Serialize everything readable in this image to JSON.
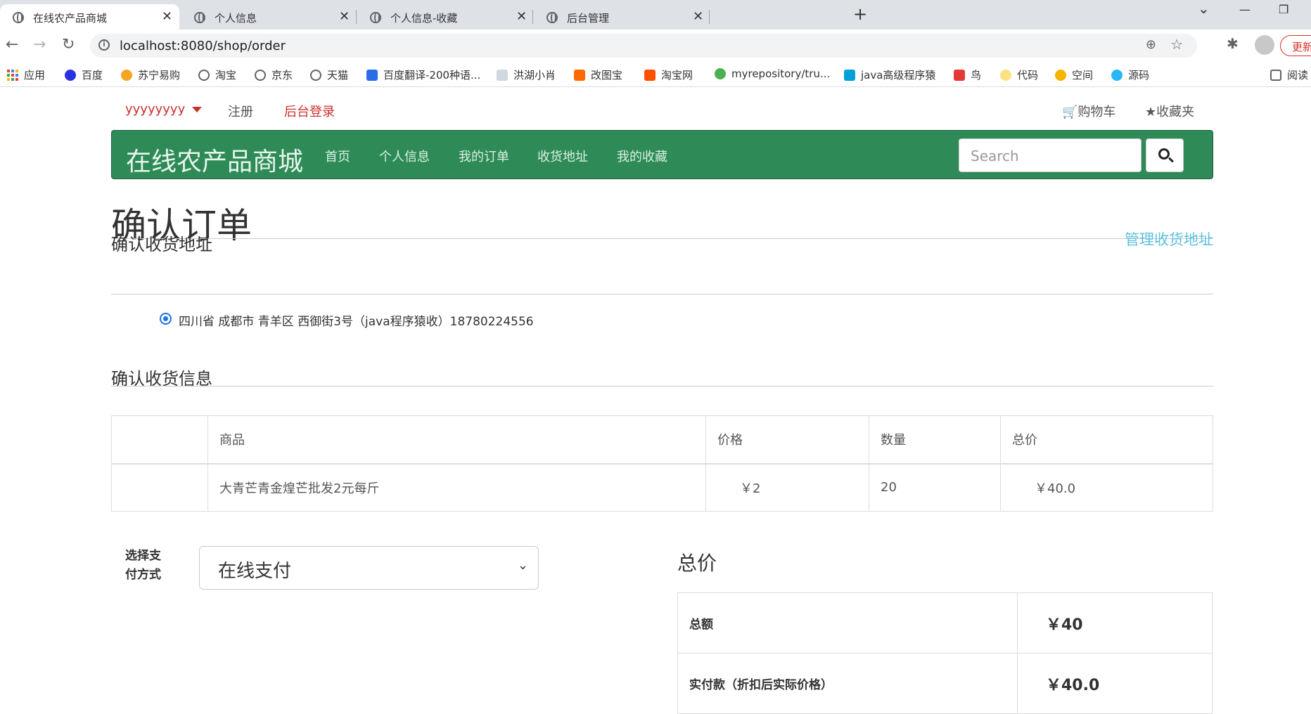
{
  "browser": {
    "tabs": [
      {
        "title": "在线农产品商城",
        "active": true
      },
      {
        "title": "个人信息",
        "active": false
      },
      {
        "title": "个人信息-收藏",
        "active": false
      },
      {
        "title": "后台管理",
        "active": false
      }
    ],
    "url": "localhost:8080/shop/order",
    "update_label": "更新",
    "bookmarks": [
      "应用",
      "百度",
      "苏宁易购",
      "淘宝",
      "京东",
      "天猫",
      "百度翻译-200种语...",
      "洪湖小肖",
      "改图宝",
      "淘宝网",
      "myrepository/tru...",
      "java高级程序猿",
      "鸟",
      "代码",
      "空间",
      "源码",
      "阅读"
    ]
  },
  "topnav": {
    "username": "yyyyyyyy",
    "register": "注册",
    "admin_login": "后台登录",
    "cart": "购物车",
    "favorites": "收藏夹"
  },
  "navbar": {
    "brand": "在线农产品商城",
    "items": [
      "首页",
      "个人信息",
      "我的订单",
      "收货地址",
      "我的收藏"
    ],
    "search_placeholder": "Search"
  },
  "page_title": "确认订单",
  "address_section": {
    "title": "确认收货地址",
    "manage_link": "管理收货地址",
    "address": "四川省 成都市 青羊区 西御街3号（java程序猿收）18780224556"
  },
  "info_section": {
    "title": "确认收货信息",
    "columns": [
      "",
      "商品",
      "价格",
      "数量",
      "总价"
    ],
    "rows": [
      {
        "image": "",
        "name": "大青芒青金煌芒批发2元每斤",
        "price": "￥2",
        "qty": "20",
        "total": "￥40.0"
      }
    ]
  },
  "payment": {
    "label": "选择支付方式",
    "selected": "在线支付"
  },
  "totals": {
    "title": "总价",
    "rows": [
      {
        "label": "总额",
        "value": "￥40"
      },
      {
        "label": "实付款（折扣后实际价格）",
        "value": "￥40.0"
      }
    ]
  },
  "colors": {
    "navbar_bg": "#2e8b57",
    "accent_red": "#c9302c",
    "link_blue": "#5bc0de"
  }
}
